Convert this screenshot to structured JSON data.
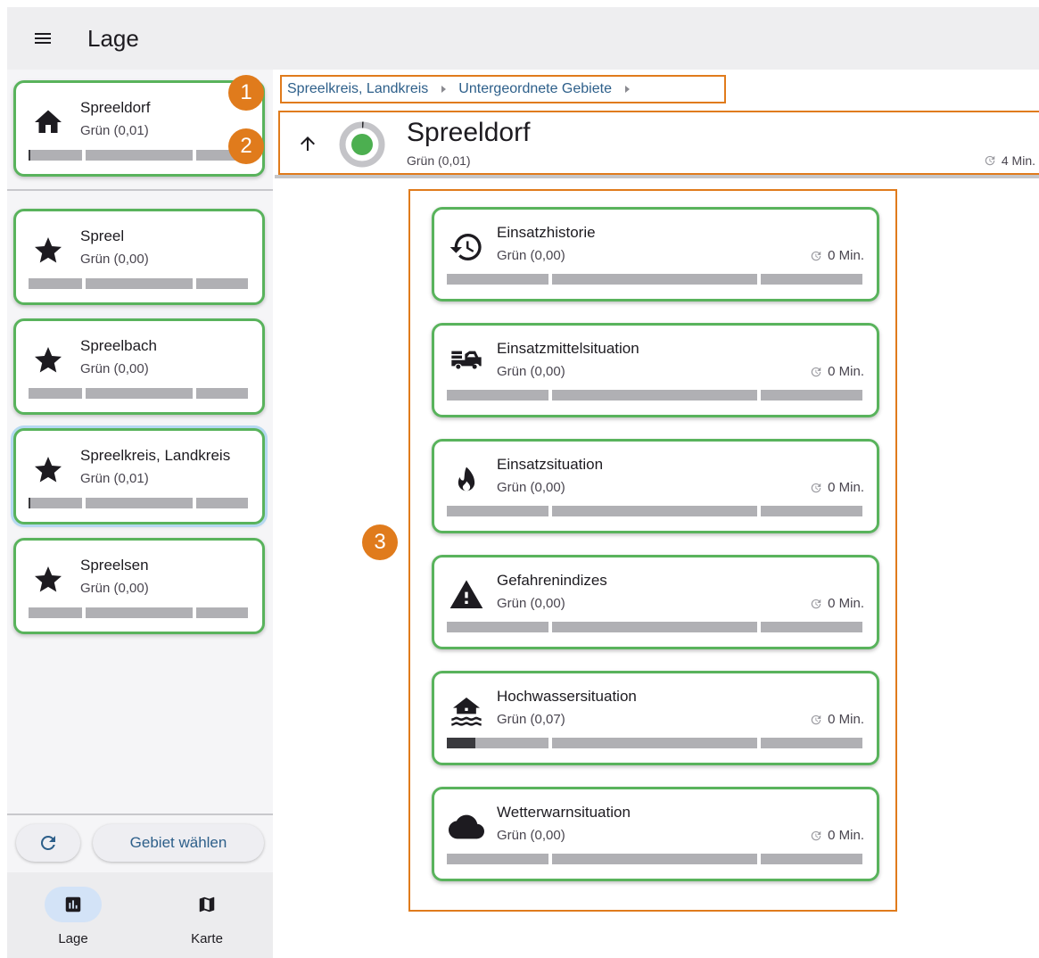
{
  "app": {
    "title": "Lage"
  },
  "sidebar": {
    "current": {
      "name": "Spreeldorf",
      "status": "Grün (0,01)",
      "icon": "home-icon",
      "progress": 0.01
    },
    "favorites": [
      {
        "name": "Spreel",
        "status": "Grün (0,00)",
        "icon": "star-icon",
        "progress": 0.0
      },
      {
        "name": "Spreelbach",
        "status": "Grün (0,00)",
        "icon": "star-icon",
        "progress": 0.0
      },
      {
        "name": "Spreelkreis, Landkreis",
        "status": "Grün (0,01)",
        "icon": "star-icon",
        "progress": 0.01
      },
      {
        "name": "Spreelsen",
        "status": "Grün (0,00)",
        "icon": "star-icon",
        "progress": 0.0
      }
    ],
    "select_area_label": "Gebiet wählen"
  },
  "bottom_nav": [
    {
      "label": "Lage",
      "icon": "chart-icon",
      "active": true
    },
    {
      "label": "Karte",
      "icon": "map-icon",
      "active": false
    }
  ],
  "breadcrumb": [
    {
      "label": "Spreelkreis, Landkreis"
    },
    {
      "label": "Untergeordnete Gebiete"
    }
  ],
  "area": {
    "name": "Spreeldorf",
    "status": "Grün (0,01)",
    "time": "4 Min.",
    "status_color": "#4caf50"
  },
  "callouts": [
    "1",
    "2",
    "3"
  ],
  "situations": [
    {
      "title": "Einsatzhistorie",
      "status": "Grün (0,00)",
      "time": "0 Min.",
      "icon": "history-icon",
      "progress": 0.0
    },
    {
      "title": "Einsatzmittelsituation",
      "status": "Grün (0,00)",
      "time": "0 Min.",
      "icon": "fire-truck-icon",
      "progress": 0.0
    },
    {
      "title": "Einsatzsituation",
      "status": "Grün (0,00)",
      "time": "0 Min.",
      "icon": "fire-icon",
      "progress": 0.0
    },
    {
      "title": "Gefahrenindizes",
      "status": "Grün (0,00)",
      "time": "0 Min.",
      "icon": "warning-icon",
      "progress": 0.0
    },
    {
      "title": "Hochwassersituation",
      "status": "Grün (0,07)",
      "time": "0 Min.",
      "icon": "flood-icon",
      "progress": 0.07
    },
    {
      "title": "Wetterwarnsituation",
      "status": "Grün (0,00)",
      "time": "0 Min.",
      "icon": "cloud-icon",
      "progress": 0.0
    }
  ],
  "colors": {
    "status_green": "#59b35c",
    "highlight_orange": "#e07b1c",
    "link_blue": "#2d5f8a"
  }
}
